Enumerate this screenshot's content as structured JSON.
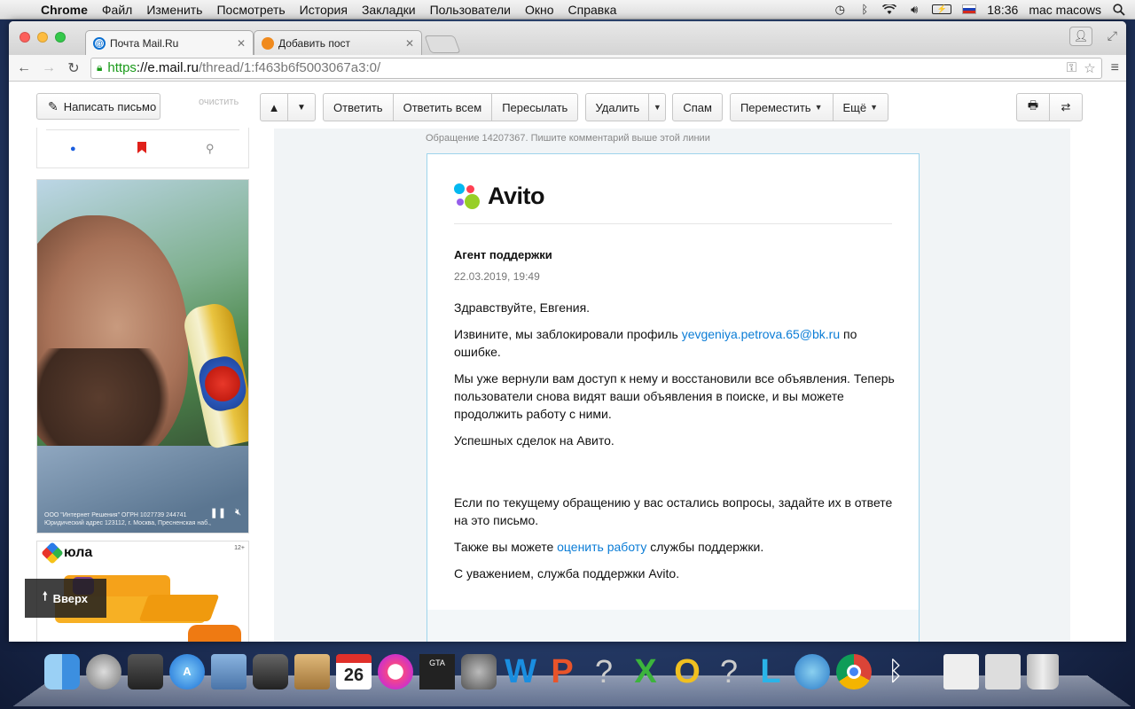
{
  "menubar": {
    "app": "Chrome",
    "items": [
      "Файл",
      "Изменить",
      "Посмотреть",
      "История",
      "Закладки",
      "Пользователи",
      "Окно",
      "Справка"
    ],
    "time": "18:36",
    "user": "mac macows"
  },
  "tabs": [
    {
      "title": "Почта Mail.Ru",
      "active": true,
      "favicon_color": "#0a6fd1"
    },
    {
      "title": "Добавить пост",
      "active": false,
      "favicon_color": "#f08a1d"
    }
  ],
  "address": {
    "scheme": "https",
    "host": "://e.mail.ru",
    "path": "/thread/1:f463b6f5003067a3:0/"
  },
  "sidebar": {
    "compose_label": "Написать письмо",
    "clear_label": "очистить"
  },
  "ads": {
    "video_legal": "ООО \"Интернет Решения\" ОГРН 1027739 244741 Юридический адрес 123112, г. Москва, Пресненская наб.,",
    "yula_brand": "юла",
    "yula_age": "12+",
    "scroll_top_label": "Вверх"
  },
  "toolbar": {
    "reply": "Ответить",
    "reply_all": "Ответить всем",
    "forward": "Пересылать",
    "delete": "Удалить",
    "spam": "Спам",
    "move": "Переместить",
    "more": "Ещё"
  },
  "message": {
    "note": "Обращение 14207367. Пишите комментарий выше этой линии",
    "brand": "Avito",
    "sender": "Агент поддержки",
    "date": "22.03.2019, 19:49",
    "greeting": "Здравствуйте, Евгения.",
    "p1_before": "Извините, мы заблокировали профиль ",
    "p1_email": "yevgeniya.petrova.65@bk.ru",
    "p1_after": " по ошибке.",
    "p2": "Мы уже вернули вам доступ к нему и восстановили все объявления. Теперь пользователи снова видят ваши объявления в поиске, и вы можете продолжить работу с ними.",
    "p3": "Успешных сделок на Авито.",
    "p4": "Если по текущему обращению у вас остались вопросы, задайте их в ответе на это письмо.",
    "p5_before": "Также вы можете ",
    "p5_link": "оценить работу",
    "p5_after": " службы поддержки.",
    "p6": "С уважением, служба поддержки Avito."
  },
  "colors": {
    "link": "#0a7cd6",
    "avito_blue": "#04b8f0",
    "avito_red": "#ff4053",
    "avito_purple": "#965eeb",
    "avito_green": "#97cf26"
  }
}
